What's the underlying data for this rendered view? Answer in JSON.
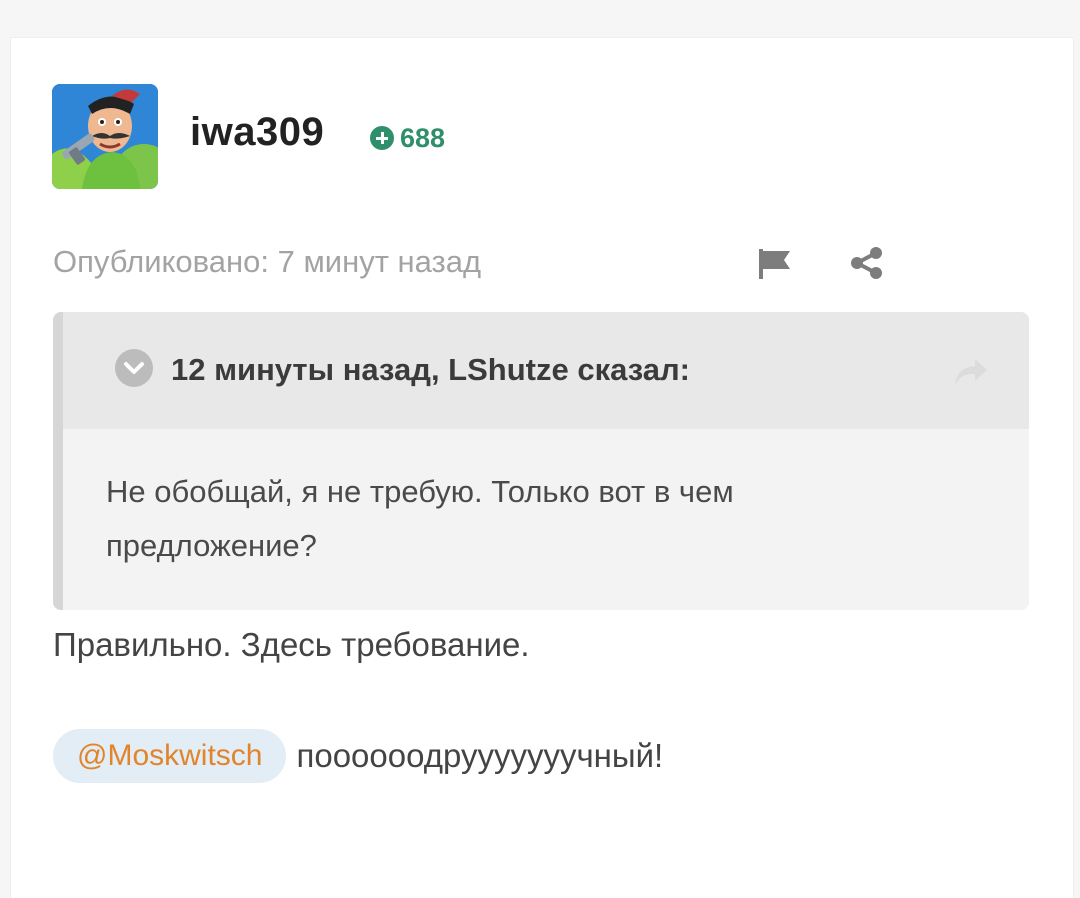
{
  "author": {
    "username": "iwa309",
    "reputation": "688",
    "avatar_icon": "cartoon-character-avatar"
  },
  "post": {
    "published": "Опубликовано: 7 минут назад",
    "actions": {
      "report_icon": "flag-icon",
      "share_icon": "share-icon"
    }
  },
  "quote": {
    "citation": "12 минуты назад, LShutze сказал:",
    "text_line1": "Не обобщай, я не требую. Только вот в чем",
    "text_line2": "предложение?"
  },
  "reply": {
    "line1": "Правильно. Здесь требование.",
    "mention": "@Moskwitsch",
    "mention_text": "поооооодрууууууучный!"
  },
  "colors": {
    "reputation": "#2f8f6a",
    "mention": "#e0852c",
    "mention_bg": "#e3edf6",
    "quote_bg": "#f3f3f3",
    "quote_header_bg": "#e8e8e8"
  }
}
